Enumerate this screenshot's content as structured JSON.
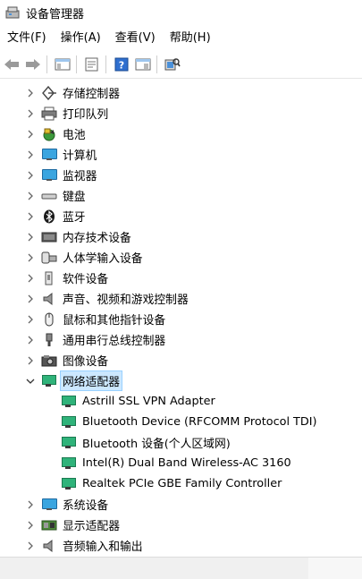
{
  "window": {
    "title": "设备管理器"
  },
  "menu": [
    "文件(F)",
    "操作(A)",
    "查看(V)",
    "帮助(H)"
  ],
  "toolbar": {
    "icons": [
      "back-arrow-icon",
      "forward-arrow-icon",
      "show-hide-tree-icon",
      "properties-icon",
      "help-icon",
      "view-icon",
      "scan-hardware-icon"
    ]
  },
  "tree": {
    "categories": [
      {
        "label": "存储控制器",
        "icon": "storage-controller-icon",
        "expanded": false
      },
      {
        "label": "打印队列",
        "icon": "printer-icon",
        "expanded": false
      },
      {
        "label": "电池",
        "icon": "battery-icon",
        "expanded": false
      },
      {
        "label": "计算机",
        "icon": "computer-icon",
        "expanded": false
      },
      {
        "label": "监视器",
        "icon": "monitor-icon",
        "expanded": false
      },
      {
        "label": "键盘",
        "icon": "keyboard-icon",
        "expanded": false
      },
      {
        "label": "蓝牙",
        "icon": "bluetooth-icon",
        "expanded": false
      },
      {
        "label": "内存技术设备",
        "icon": "memory-device-icon",
        "expanded": false
      },
      {
        "label": "人体学输入设备",
        "icon": "hid-icon",
        "expanded": false
      },
      {
        "label": "软件设备",
        "icon": "software-device-icon",
        "expanded": false
      },
      {
        "label": "声音、视频和游戏控制器",
        "icon": "speaker-icon",
        "expanded": false
      },
      {
        "label": "鼠标和其他指针设备",
        "icon": "mouse-icon",
        "expanded": false
      },
      {
        "label": "通用串行总线控制器",
        "icon": "usb-icon",
        "expanded": false
      },
      {
        "label": "图像设备",
        "icon": "camera-icon",
        "expanded": false
      },
      {
        "label": "网络适配器",
        "icon": "network-adapter-icon",
        "expanded": true,
        "selected": true
      },
      {
        "label": "系统设备",
        "icon": "system-device-icon",
        "expanded": false
      },
      {
        "label": "显示适配器",
        "icon": "display-adapter-icon",
        "expanded": false
      },
      {
        "label": "音频输入和输出",
        "icon": "audio-io-icon",
        "expanded": false
      }
    ],
    "network_adapters": [
      "Astrill SSL VPN Adapter",
      "Bluetooth Device (RFCOMM Protocol TDI)",
      "Bluetooth 设备(个人区域网)",
      "Intel(R) Dual Band Wireless-AC 3160",
      "Realtek PCIe GBE Family Controller"
    ]
  }
}
